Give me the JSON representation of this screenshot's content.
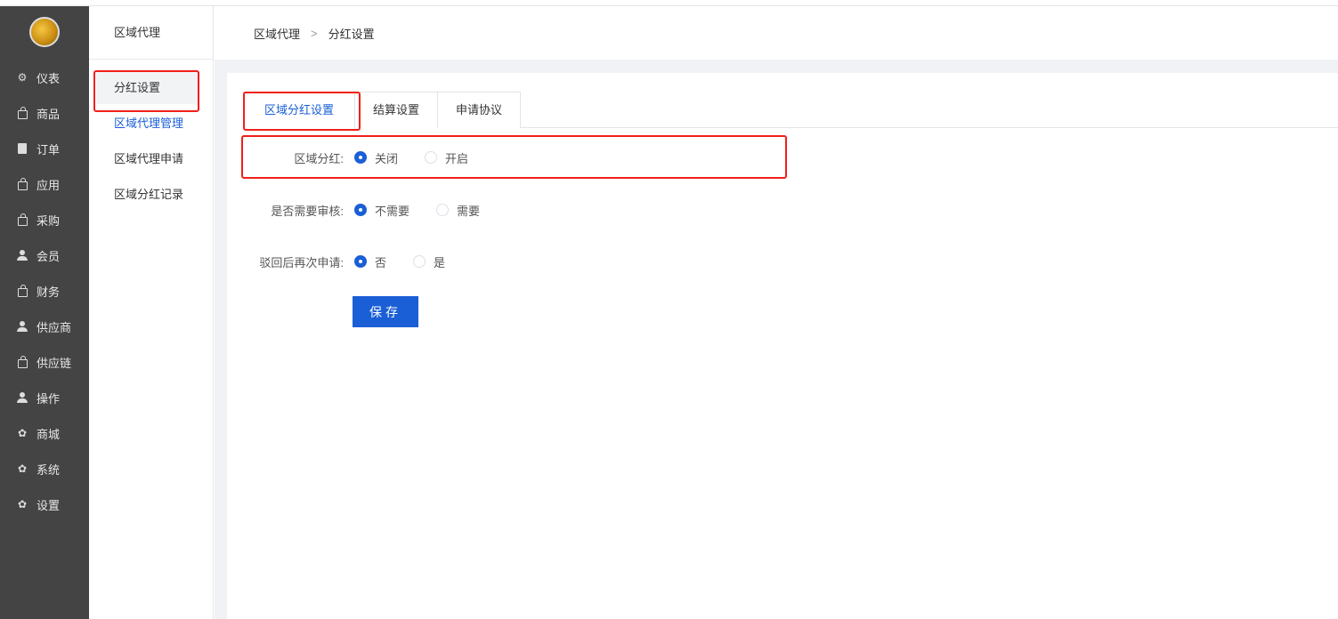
{
  "nav": {
    "items": [
      {
        "label": "仪表",
        "icon": "gear-icon"
      },
      {
        "label": "商品",
        "icon": "bag-icon"
      },
      {
        "label": "订单",
        "icon": "clipboard-icon"
      },
      {
        "label": "应用",
        "icon": "bag-icon"
      },
      {
        "label": "采购",
        "icon": "bag-icon"
      },
      {
        "label": "会员",
        "icon": "person-icon"
      },
      {
        "label": "财务",
        "icon": "bag-icon"
      },
      {
        "label": "供应商",
        "icon": "person-icon"
      },
      {
        "label": "供应链",
        "icon": "bag-icon"
      },
      {
        "label": "操作",
        "icon": "person-icon"
      },
      {
        "label": "商城",
        "icon": "cog-icon"
      },
      {
        "label": "系统",
        "icon": "cog-icon"
      },
      {
        "label": "设置",
        "icon": "cog-icon"
      }
    ]
  },
  "sub": {
    "title": "区域代理",
    "items": [
      "分红设置",
      "区域代理管理",
      "区域代理申请",
      "区域分红记录"
    ]
  },
  "breadcrumb": {
    "parent": "区域代理",
    "current": "分红设置"
  },
  "tabs": [
    "区域分红设置",
    "结算设置",
    "申请协议"
  ],
  "form": {
    "rows": [
      {
        "label": "区域分红:",
        "options": [
          "关闭",
          "开启"
        ],
        "selected": 0
      },
      {
        "label": "是否需要审核:",
        "options": [
          "不需要",
          "需要"
        ],
        "selected": 0
      },
      {
        "label": "驳回后再次申请:",
        "options": [
          "否",
          "是"
        ],
        "selected": 0
      }
    ],
    "save_label": "保存"
  },
  "colors": {
    "accent": "#1a5fd6",
    "highlight": "#f0201a",
    "nav_bg": "#444444"
  }
}
